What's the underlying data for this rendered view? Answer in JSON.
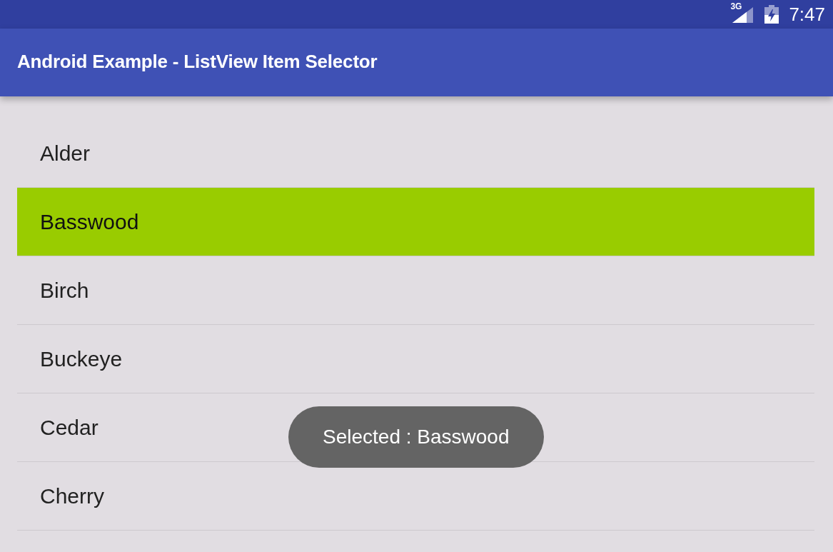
{
  "status_bar": {
    "network": "3G",
    "time": "7:47"
  },
  "app_bar": {
    "title": "Android Example - ListView Item Selector"
  },
  "list": {
    "items": [
      {
        "label": "Alder",
        "selected": false
      },
      {
        "label": "Basswood",
        "selected": true
      },
      {
        "label": "Birch",
        "selected": false
      },
      {
        "label": "Buckeye",
        "selected": false
      },
      {
        "label": "Cedar",
        "selected": false
      },
      {
        "label": "Cherry",
        "selected": false
      }
    ]
  },
  "toast": {
    "text": "Selected : Basswood"
  }
}
